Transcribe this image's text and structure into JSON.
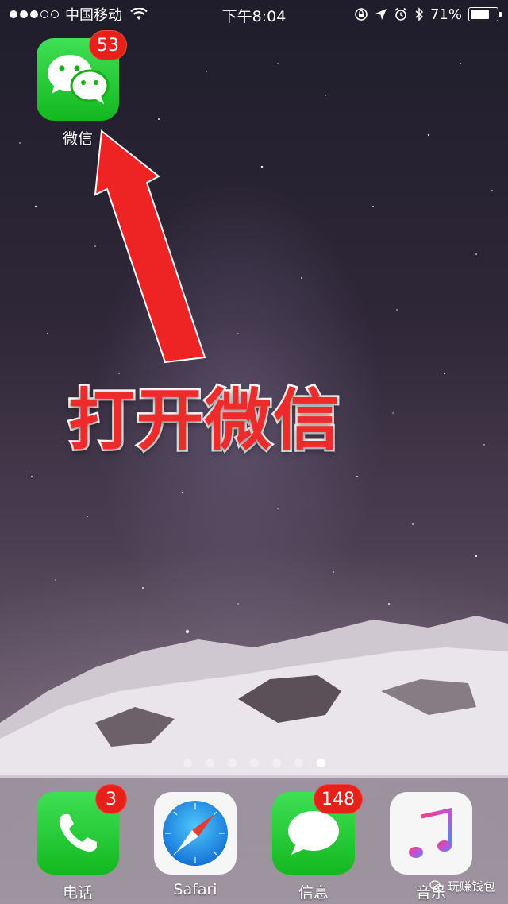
{
  "status_bar": {
    "carrier": "中国移动",
    "time": "下午8:04",
    "battery_percent": "71%",
    "battery_level": 0.71,
    "signal_bars_filled": 3,
    "signal_bars_total": 5
  },
  "home": {
    "wechat": {
      "label": "微信",
      "badge": "53",
      "icon": "wechat-icon"
    }
  },
  "annotation": {
    "text": "打开微信",
    "color": "#ee2b2b"
  },
  "page_indicator": {
    "count": 7,
    "active_index": 6
  },
  "dock": {
    "apps": [
      {
        "label": "电话",
        "badge": "3",
        "icon": "phone-icon"
      },
      {
        "label": "Safari",
        "badge": "",
        "icon": "compass-icon"
      },
      {
        "label": "信息",
        "badge": "148",
        "icon": "message-icon"
      },
      {
        "label": "音乐",
        "badge": "",
        "icon": "music-note-icon"
      }
    ]
  },
  "watermark": {
    "text": "玩赚钱包"
  }
}
